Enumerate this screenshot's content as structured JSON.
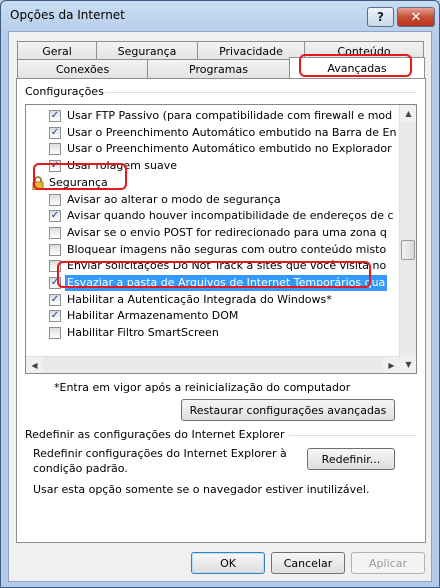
{
  "window": {
    "title": "Opções da Internet",
    "help_label": "?",
    "close_label": "✕"
  },
  "tabs": {
    "row1": [
      "Geral",
      "Segurança",
      "Privacidade",
      "Conteúdo"
    ],
    "row2": [
      "Conexões",
      "Programas",
      "Avançadas"
    ],
    "active": "Avançadas"
  },
  "settings": {
    "group_label": "Configurações",
    "rows": [
      {
        "type": "option",
        "checked": true,
        "label": "Usar FTP Passivo (para compatibilidade com firewall e mod"
      },
      {
        "type": "option",
        "checked": true,
        "label": "Usar o Preenchimento Automático embutido na Barra de En"
      },
      {
        "type": "option",
        "checked": false,
        "label": "Usar o Preenchimento Automático embutido no Explorador"
      },
      {
        "type": "option",
        "checked": true,
        "label": "Usar rolagem suave"
      },
      {
        "type": "category",
        "label": "Segurança"
      },
      {
        "type": "option",
        "checked": false,
        "label": "Avisar ao alterar o modo de segurança"
      },
      {
        "type": "option",
        "checked": true,
        "label": "Avisar quando houver incompatibilidade de endereços de c"
      },
      {
        "type": "option",
        "checked": false,
        "label": "Avisar se o envio POST for redirecionado para uma zona q"
      },
      {
        "type": "option",
        "checked": false,
        "label": "Bloquear imagens não seguras com outro conteúdo misto"
      },
      {
        "type": "option",
        "checked": false,
        "label": "Enviar solicitações Do Not Track a sites que você visita no"
      },
      {
        "type": "option",
        "checked": true,
        "selected": true,
        "label": "Esvaziar a pasta de Arquivos de Internet Temporários qua"
      },
      {
        "type": "option",
        "checked": true,
        "label": "Habilitar a Autenticação Integrada do Windows*"
      },
      {
        "type": "option",
        "checked": true,
        "label": "Habilitar Armazenamento DOM"
      },
      {
        "type": "option",
        "checked": false,
        "label": "Habilitar Filtro SmartScreen"
      }
    ],
    "note": "*Entra em vigor após a reinicialização do computador",
    "restore_button": "Restaurar configurações avançadas"
  },
  "reset": {
    "group_label": "Redefinir as configurações do Internet Explorer",
    "description": "Redefinir configurações do Internet Explorer à condição padrão.",
    "button": "Redefinir...",
    "hint": "Usar esta opção somente se o navegador estiver inutilizável."
  },
  "footer": {
    "ok": "OK",
    "cancel": "Cancelar",
    "apply": "Aplicar"
  },
  "colors": {
    "annotation": "#e8171c",
    "selection": "#3399ff",
    "title_bar": "#b3cbe8"
  }
}
